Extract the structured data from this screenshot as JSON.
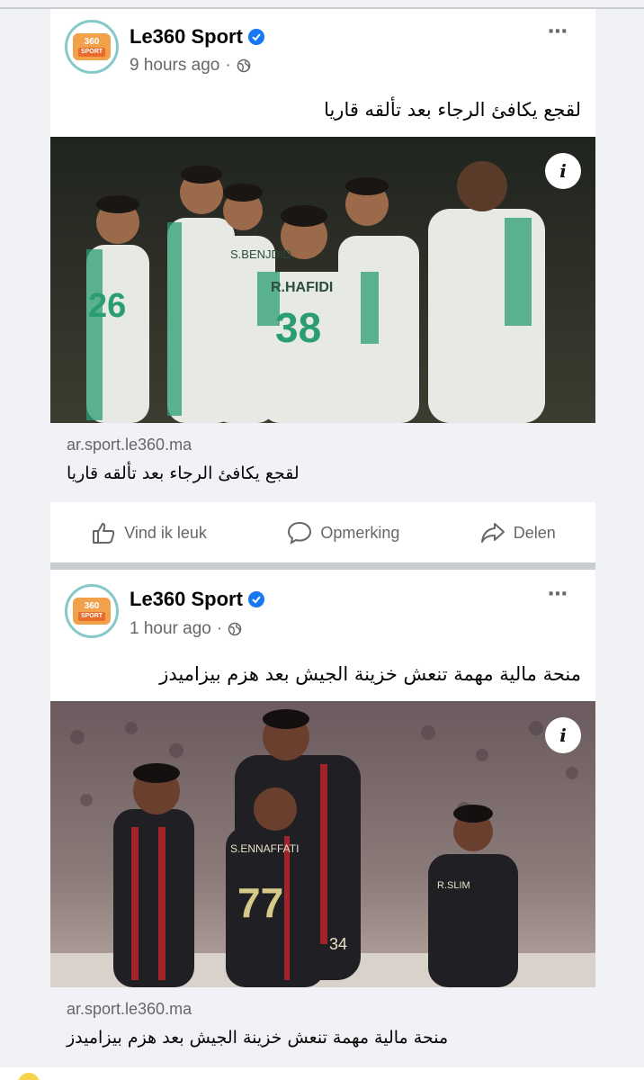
{
  "posts": [
    {
      "page_name": "Le360 Sport",
      "time": "9 hours ago",
      "caption": "لقجع يكافئ الرجاء بعد تألقه قاريا",
      "link_domain": "ar.sport.le360.ma",
      "link_title": "لقجع يكافئ الرجاء بعد تألقه قاريا",
      "info_label": "i",
      "jersey_names": [
        "S.BENJDID",
        "R.HAFIDI"
      ],
      "jersey_numbers": [
        "26",
        "38"
      ],
      "actions": {
        "like": "Vind ik leuk",
        "comment": "Opmerking",
        "share": "Delen"
      }
    },
    {
      "page_name": "Le360 Sport",
      "time": "1 hour ago",
      "caption": "منحة مالية مهمة تنعش خزينة الجيش بعد هزم بيزاميدز",
      "link_domain": "ar.sport.le360.ma",
      "link_title": "منحة مالية مهمة تنعش خزينة الجيش بعد هزم بيزاميدز",
      "info_label": "i",
      "jersey_names": [
        "S.ENNAFFATI",
        "R.SLIM"
      ],
      "jersey_numbers": [
        "77",
        "34"
      ]
    }
  ],
  "logo": {
    "line1": "360",
    "line2": "SPORT"
  },
  "more_icon": "⋯",
  "colors": {
    "verified": "#1877f2",
    "raja_green": "#2a9d74",
    "far_red": "#b8262c",
    "muted": "#65676b"
  }
}
